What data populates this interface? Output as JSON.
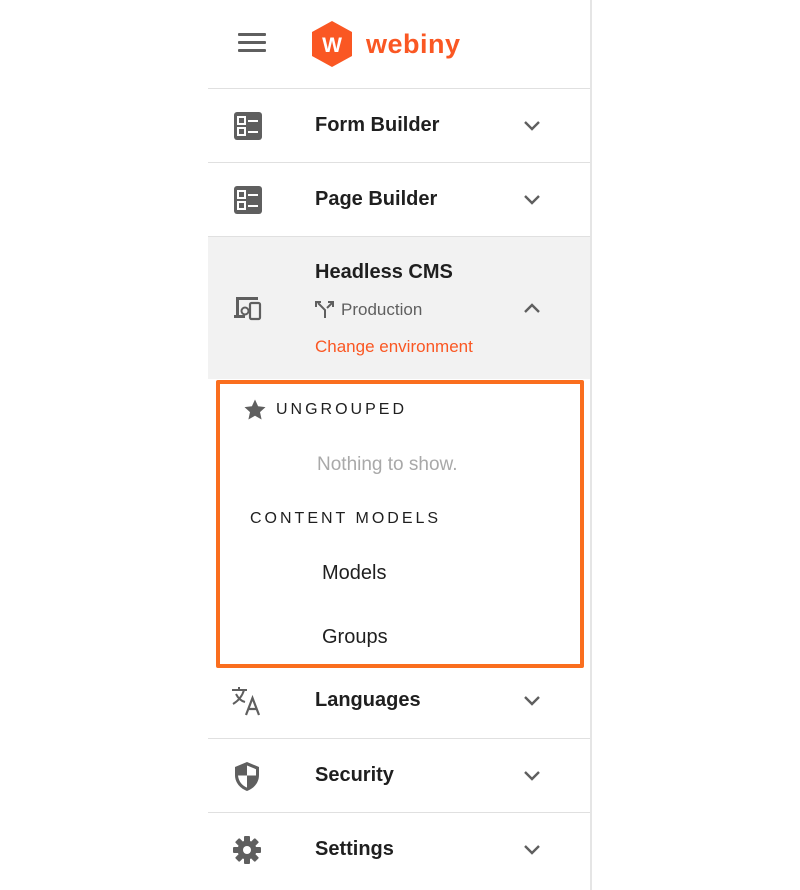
{
  "header": {
    "logo_letter": "W",
    "logo_text": "webiny",
    "brand_color": "#fa5723"
  },
  "menu": {
    "form_builder": {
      "label": "Form Builder",
      "icon": "form-icon"
    },
    "page_builder": {
      "label": "Page Builder",
      "icon": "form-icon"
    },
    "headless_cms": {
      "label": "Headless CMS",
      "icon": "devices-icon",
      "environment": "Production",
      "change_environment": "Change environment"
    },
    "languages": {
      "label": "Languages",
      "icon": "translate-icon"
    },
    "security": {
      "label": "Security",
      "icon": "shield-icon"
    },
    "settings": {
      "label": "Settings",
      "icon": "gear-icon"
    }
  },
  "cms_submenu": {
    "ungrouped_label": "UNGROUPED",
    "empty_text": "Nothing to show.",
    "content_models_label": "CONTENT MODELS",
    "models": "Models",
    "groups": "Groups",
    "highlight_color": "#fa6e1e"
  }
}
